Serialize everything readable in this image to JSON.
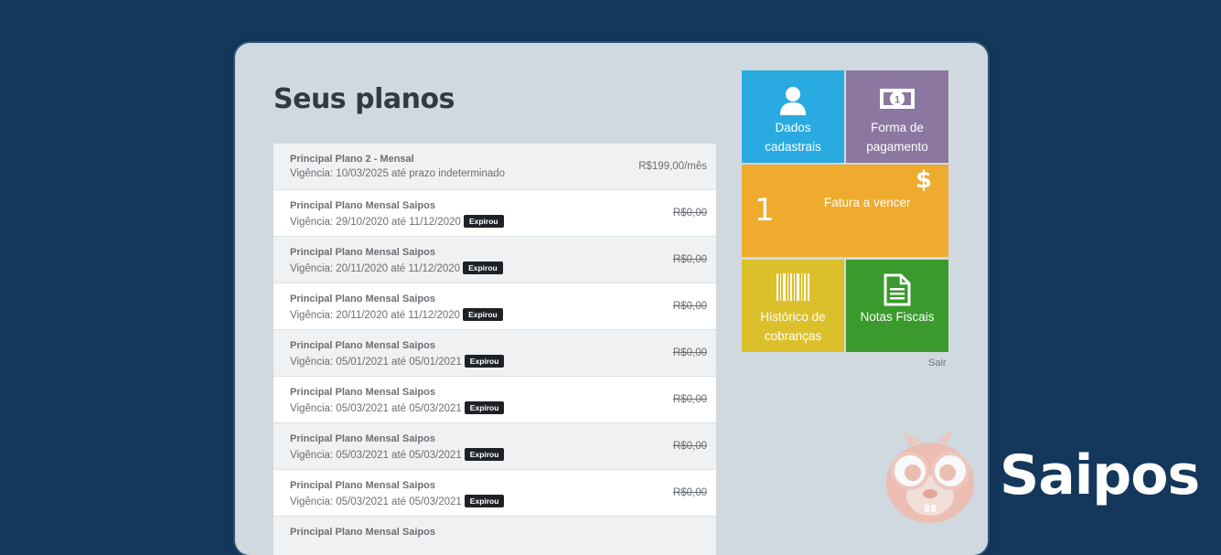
{
  "page": {
    "title": "Seus planos"
  },
  "plans": [
    {
      "name": "Principal Plano 2 - Mensal",
      "validity": "Vigência: 10/03/2025 até prazo indeterminado",
      "badge": "",
      "price": "R$199,00/mês"
    },
    {
      "name": "Principal Plano Mensal Saipos",
      "validity": "Vigência: 29/10/2020 até 11/12/2020",
      "badge": "Expirou",
      "price": "R$0,00"
    },
    {
      "name": "Principal Plano Mensal Saipos",
      "validity": "Vigência: 20/11/2020 até 11/12/2020",
      "badge": "Expirou",
      "price": "R$0,00"
    },
    {
      "name": "Principal Plano Mensal Saipos",
      "validity": "Vigência: 20/11/2020 até 11/12/2020",
      "badge": "Expirou",
      "price": "R$0,00"
    },
    {
      "name": "Principal Plano Mensal Saipos",
      "validity": "Vigência: 05/01/2021 até 05/01/2021",
      "badge": "Expirou",
      "price": "R$0,00"
    },
    {
      "name": "Principal Plano Mensal Saipos",
      "validity": "Vigência: 05/03/2021 até 05/03/2021",
      "badge": "Expirou",
      "price": "R$0,00"
    },
    {
      "name": "Principal Plano Mensal Saipos",
      "validity": "Vigência: 05/03/2021 até 05/03/2021",
      "badge": "Expirou",
      "price": "R$0,00"
    },
    {
      "name": "Principal Plano Mensal Saipos",
      "validity": "Vigência: 05/03/2021 até 05/03/2021",
      "badge": "Expirou",
      "price": "R$0,00"
    },
    {
      "name": "Principal Plano Mensal Saipos",
      "validity": "",
      "badge": "",
      "price": ""
    }
  ],
  "tiles": {
    "dados": {
      "label_line1": "Dados",
      "label_line2": "cadastrais",
      "icon": "user-icon",
      "color": "#29abe2"
    },
    "forma": {
      "label_line1": "Forma de",
      "label_line2": "pagamento",
      "icon": "money-icon",
      "color": "#8b77a0"
    },
    "fatura": {
      "label": "Fatura a vencer",
      "count": "1",
      "symbol": "$",
      "icon": "dollar-icon",
      "color": "#eeab2e"
    },
    "historico": {
      "label_line1": "Histórico de",
      "label_line2": "cobranças",
      "icon": "barcode-icon",
      "color": "#dbc02c"
    },
    "notas": {
      "label": "Notas Fiscais",
      "icon": "document-icon",
      "color": "#3a9a2d"
    }
  },
  "sair_label": "Sair",
  "brand": {
    "name": "Saipos",
    "mascot": "squirrel-mascot-icon"
  },
  "colors": {
    "background": "#14385b",
    "panel": "#d0d9e0",
    "badge": "#1e2226"
  }
}
